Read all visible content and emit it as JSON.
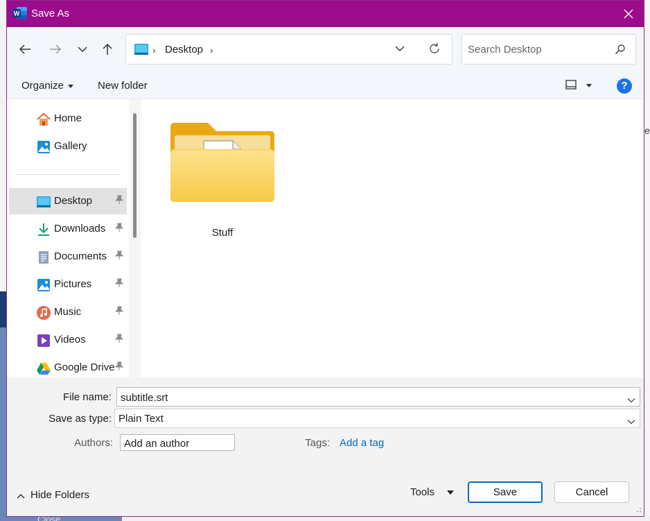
{
  "window": {
    "title": "Save As"
  },
  "nav": {
    "breadcrumb": [
      "Desktop"
    ],
    "search_placeholder": "Search Desktop"
  },
  "toolbar": {
    "organize_label": "Organize",
    "new_folder_label": "New folder",
    "help_label": "?"
  },
  "sidebar": {
    "items": [
      {
        "label": "Home",
        "icon": "home-icon",
        "pinned": false
      },
      {
        "label": "Gallery",
        "icon": "gallery-icon",
        "pinned": false
      },
      {
        "label": "Desktop",
        "icon": "desktop-icon",
        "pinned": true,
        "selected": true
      },
      {
        "label": "Downloads",
        "icon": "downloads-icon",
        "pinned": true
      },
      {
        "label": "Documents",
        "icon": "documents-icon",
        "pinned": true
      },
      {
        "label": "Pictures",
        "icon": "pictures-icon",
        "pinned": true
      },
      {
        "label": "Music",
        "icon": "music-icon",
        "pinned": true
      },
      {
        "label": "Videos",
        "icon": "videos-icon",
        "pinned": true
      },
      {
        "label": "Google Drive",
        "icon": "google-drive-icon",
        "pinned": true
      }
    ]
  },
  "content": {
    "items": [
      {
        "name": "Stuff",
        "type": "folder"
      }
    ]
  },
  "form": {
    "file_name_label": "File name:",
    "file_name_value": "subtitle.srt",
    "save_type_label": "Save as type:",
    "save_type_value": "Plain Text",
    "authors_label": "Authors:",
    "authors_value": "Add an author",
    "tags_label": "Tags:",
    "tags_link": "Add a tag"
  },
  "footer": {
    "hide_folders_label": "Hide Folders",
    "tools_label": "Tools",
    "save_label": "Save",
    "cancel_label": "Cancel"
  },
  "background": {
    "close_text": "Close"
  },
  "colors": {
    "titlebar": "#9c0b8a",
    "accent": "#0067c0",
    "link": "#0067c0"
  }
}
